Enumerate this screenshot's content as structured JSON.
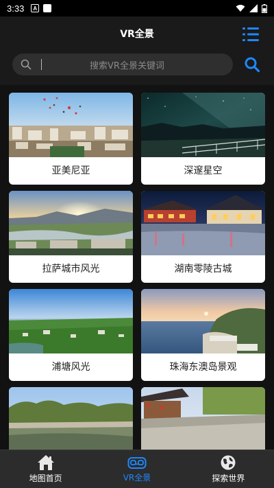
{
  "status": {
    "time": "3:33"
  },
  "header": {
    "title": "VR全景"
  },
  "search": {
    "placeholder": "搜索VR全景关键词"
  },
  "cards": [
    {
      "label": "亚美尼亚"
    },
    {
      "label": "深邃星空"
    },
    {
      "label": "拉萨城市风光"
    },
    {
      "label": "湖南零陵古城"
    },
    {
      "label": "浦塘风光"
    },
    {
      "label": "珠海东澳岛景观"
    },
    {
      "label": ""
    },
    {
      "label": ""
    }
  ],
  "tabs": [
    {
      "label": "地图首页",
      "icon": "home-icon",
      "active": false
    },
    {
      "label": "VR全景",
      "icon": "vr-goggles-icon",
      "active": true
    },
    {
      "label": "探索世界",
      "icon": "globe-icon",
      "active": false
    }
  ],
  "colors": {
    "accent": "#1e88ff",
    "background": "#121212",
    "tabbar": "#2c2c2c"
  }
}
